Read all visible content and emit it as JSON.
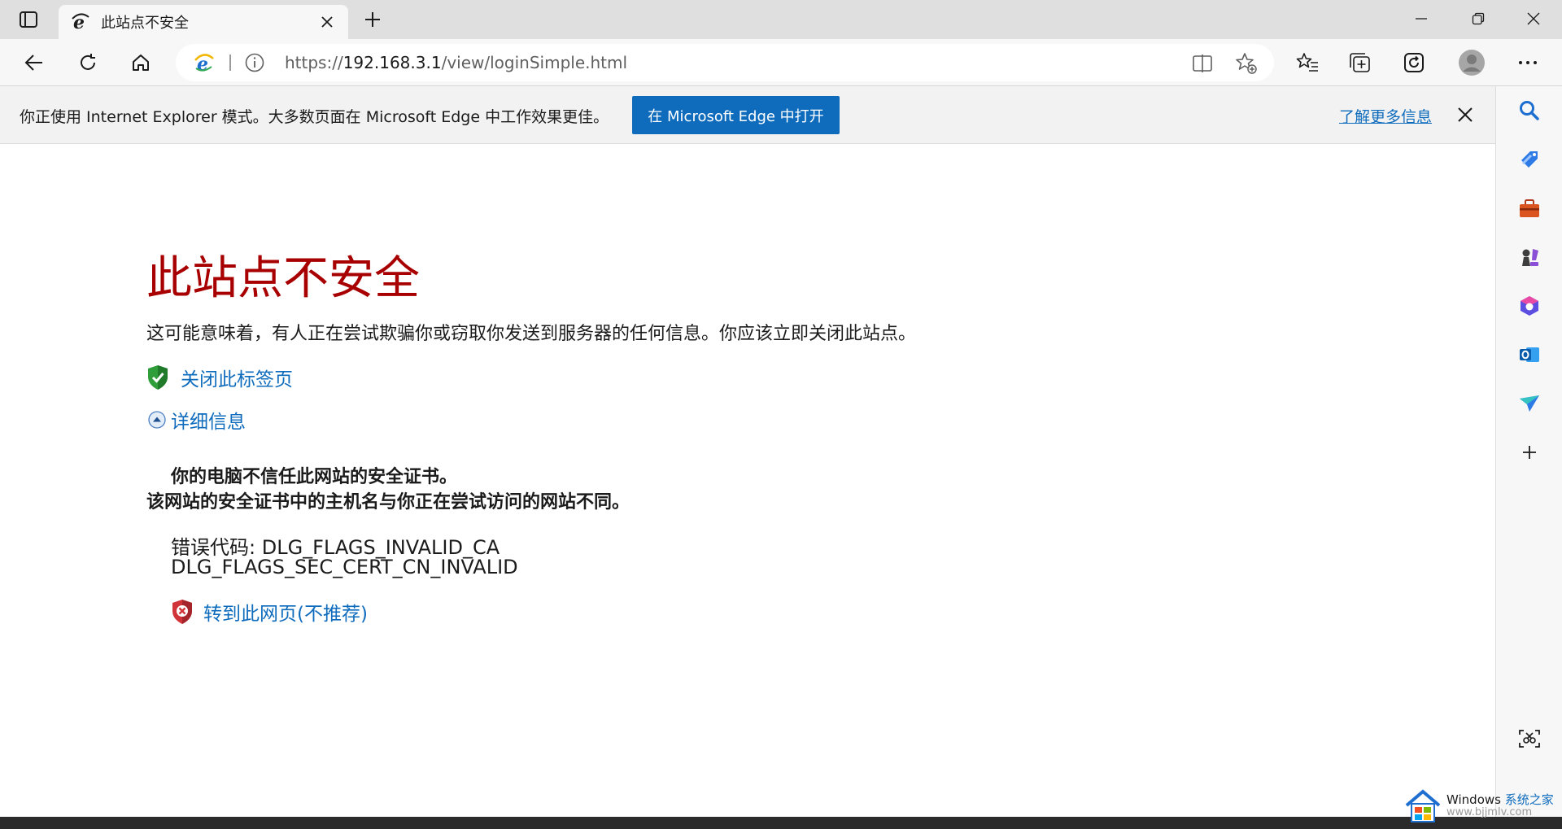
{
  "tab": {
    "title": "此站点不安全"
  },
  "address_bar": {
    "url_prefix": "https://",
    "url_host": "192.168.3.1",
    "url_path": "/view/loginSimple.html"
  },
  "infobar": {
    "message": "你正使用 Internet Explorer 模式。大多数页面在 Microsoft Edge 中工作效果更佳。",
    "open_button": "在 Microsoft Edge 中打开",
    "learn_more": "了解更多信息"
  },
  "page": {
    "title": "此站点不安全",
    "description": "这可能意味着，有人正在尝试欺骗你或窃取你发送到服务器的任何信息。你应该立即关闭此站点。",
    "close_tab_link": "关闭此标签页",
    "details_link": "详细信息",
    "detail_line1": "你的电脑不信任此网站的安全证书。",
    "detail_line2": "该网站的安全证书中的主机名与你正在尝试访问的网站不同。",
    "error_code_line1": "错误代码: DLG_FLAGS_INVALID_CA",
    "error_code_line2": "DLG_FLAGS_SEC_CERT_CN_INVALID",
    "goto_link": "转到此网页(不推荐)"
  },
  "watermark": {
    "line1_en": "Windows ",
    "line1_cn": "系统之家",
    "line2": "www.bjjmlv.com"
  },
  "colors": {
    "accent": "#0f6cbd",
    "error_title": "#a80000",
    "titlebar": "#dfdfdf",
    "toolbar": "#f7f7f7"
  }
}
